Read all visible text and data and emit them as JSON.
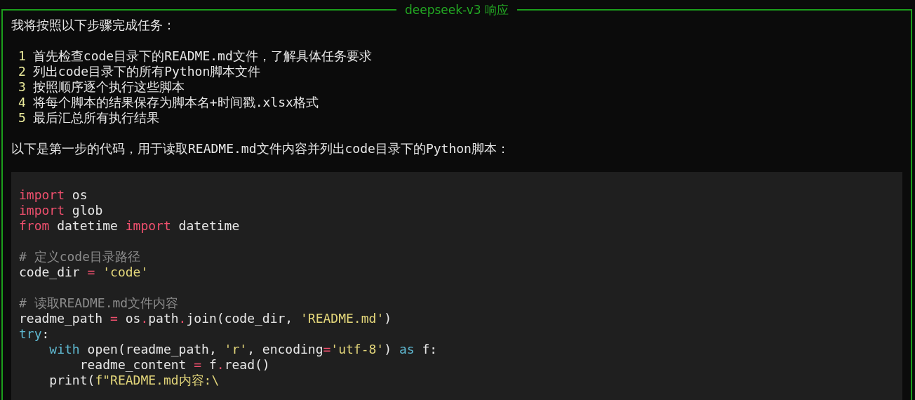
{
  "panel": {
    "title": "deepseek-v3 响应"
  },
  "intro": "我将按照以下步骤完成任务：",
  "steps": [
    {
      "number": "1",
      "text": "首先检查code目录下的README.md文件，了解具体任务要求"
    },
    {
      "number": "2",
      "text": "列出code目录下的所有Python脚本文件"
    },
    {
      "number": "3",
      "text": "按照顺序逐个执行这些脚本"
    },
    {
      "number": "4",
      "text": "将每个脚本的结果保存为脚本名+时间戳.xlsx格式"
    },
    {
      "number": "5",
      "text": "最后汇总所有执行结果"
    }
  ],
  "lead": "以下是第一步的代码，用于读取README.md文件内容并列出code目录下的Python脚本：",
  "code_blocks": [
    [
      [
        {
          "kind": "keyword",
          "text": "import"
        },
        {
          "kind": "plain",
          "text": " os"
        }
      ],
      [
        {
          "kind": "keyword",
          "text": "import"
        },
        {
          "kind": "plain",
          "text": " glob"
        }
      ],
      [
        {
          "kind": "keyword",
          "text": "from"
        },
        {
          "kind": "plain",
          "text": " datetime "
        },
        {
          "kind": "keyword",
          "text": "import"
        },
        {
          "kind": "plain",
          "text": " datetime"
        }
      ]
    ],
    [
      [
        {
          "kind": "comment",
          "text": "# 定义code目录路径"
        }
      ],
      [
        {
          "kind": "plain",
          "text": "code_dir "
        },
        {
          "kind": "operator",
          "text": "="
        },
        {
          "kind": "string",
          "text": " 'code'"
        }
      ]
    ],
    [
      [
        {
          "kind": "comment",
          "text": "# 读取README.md文件内容"
        }
      ],
      [
        {
          "kind": "plain",
          "text": "readme_path "
        },
        {
          "kind": "operator",
          "text": "="
        },
        {
          "kind": "plain",
          "text": " os"
        },
        {
          "kind": "operator",
          "text": "."
        },
        {
          "kind": "plain",
          "text": "path"
        },
        {
          "kind": "operator",
          "text": "."
        },
        {
          "kind": "plain",
          "text": "join(code_dir, "
        },
        {
          "kind": "string",
          "text": "'README.md'"
        },
        {
          "kind": "plain",
          "text": ")"
        }
      ],
      [
        {
          "kind": "builtin",
          "text": "try"
        },
        {
          "kind": "plain",
          "text": ":"
        }
      ],
      [
        {
          "kind": "builtin",
          "text": "    with"
        },
        {
          "kind": "plain",
          "text": " open(readme_path, "
        },
        {
          "kind": "string",
          "text": "'r'"
        },
        {
          "kind": "plain",
          "text": ", encoding"
        },
        {
          "kind": "operator",
          "text": "="
        },
        {
          "kind": "string",
          "text": "'utf-8'"
        },
        {
          "kind": "plain",
          "text": ") "
        },
        {
          "kind": "builtin",
          "text": "as"
        },
        {
          "kind": "plain",
          "text": " f:"
        }
      ],
      [
        {
          "kind": "plain",
          "text": "        readme_content "
        },
        {
          "kind": "operator",
          "text": "="
        },
        {
          "kind": "plain",
          "text": " f"
        },
        {
          "kind": "operator",
          "text": "."
        },
        {
          "kind": "plain",
          "text": "read()"
        }
      ],
      [
        {
          "kind": "plain",
          "text": "    print("
        },
        {
          "kind": "string",
          "text": "f\"README.md内容:\\"
        }
      ]
    ]
  ]
}
